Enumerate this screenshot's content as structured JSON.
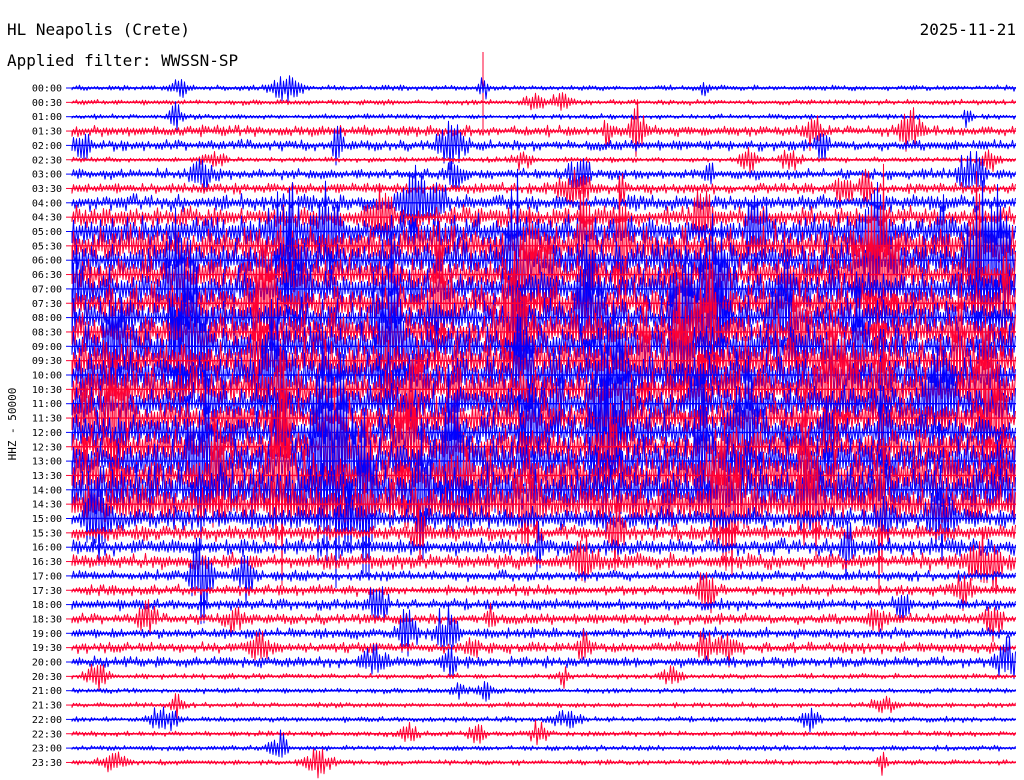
{
  "header": {
    "station": "HL Neapolis (Crete)",
    "date": "2025-11-21",
    "filter": "Applied filter: WWSSN-SP"
  },
  "colors": {
    "trace_a": "#0000ff",
    "trace_b": "#ff0033",
    "text": "#000000",
    "background": "#ffffff"
  },
  "chart_data": {
    "type": "line",
    "ylabel": "HHZ - 50000",
    "grid": false,
    "legend": "none",
    "rows": [
      {
        "label": "00:00",
        "amplitude": 1
      },
      {
        "label": "00:30",
        "amplitude": 1
      },
      {
        "label": "01:00",
        "amplitude": 1
      },
      {
        "label": "01:30",
        "amplitude": 2
      },
      {
        "label": "02:00",
        "amplitude": 2
      },
      {
        "label": "02:30",
        "amplitude": 1
      },
      {
        "label": "03:00",
        "amplitude": 2
      },
      {
        "label": "03:30",
        "amplitude": 2
      },
      {
        "label": "04:00",
        "amplitude": 3
      },
      {
        "label": "04:30",
        "amplitude": 4
      },
      {
        "label": "05:00",
        "amplitude": 6
      },
      {
        "label": "05:30",
        "amplitude": 7
      },
      {
        "label": "06:00",
        "amplitude": 7
      },
      {
        "label": "06:30",
        "amplitude": 7
      },
      {
        "label": "07:00",
        "amplitude": 7
      },
      {
        "label": "07:30",
        "amplitude": 7
      },
      {
        "label": "08:00",
        "amplitude": 7
      },
      {
        "label": "08:30",
        "amplitude": 7
      },
      {
        "label": "09:00",
        "amplitude": 8
      },
      {
        "label": "09:30",
        "amplitude": 8
      },
      {
        "label": "10:00",
        "amplitude": 8
      },
      {
        "label": "10:30",
        "amplitude": 8
      },
      {
        "label": "11:00",
        "amplitude": 7
      },
      {
        "label": "11:30",
        "amplitude": 7
      },
      {
        "label": "12:00",
        "amplitude": 7
      },
      {
        "label": "12:30",
        "amplitude": 7
      },
      {
        "label": "13:00",
        "amplitude": 8
      },
      {
        "label": "13:30",
        "amplitude": 9
      },
      {
        "label": "14:00",
        "amplitude": 9
      },
      {
        "label": "14:30",
        "amplitude": 8
      },
      {
        "label": "15:00",
        "amplitude": 4
      },
      {
        "label": "15:30",
        "amplitude": 3
      },
      {
        "label": "16:00",
        "amplitude": 3
      },
      {
        "label": "16:30",
        "amplitude": 3
      },
      {
        "label": "17:00",
        "amplitude": 2
      },
      {
        "label": "17:30",
        "amplitude": 2
      },
      {
        "label": "18:00",
        "amplitude": 2
      },
      {
        "label": "18:30",
        "amplitude": 2
      },
      {
        "label": "19:00",
        "amplitude": 2
      },
      {
        "label": "19:30",
        "amplitude": 2
      },
      {
        "label": "20:00",
        "amplitude": 2
      },
      {
        "label": "20:30",
        "amplitude": 1
      },
      {
        "label": "21:00",
        "amplitude": 1
      },
      {
        "label": "21:30",
        "amplitude": 1
      },
      {
        "label": "22:00",
        "amplitude": 1
      },
      {
        "label": "22:30",
        "amplitude": 1
      },
      {
        "label": "23:00",
        "amplitude": 1
      },
      {
        "label": "23:30",
        "amplitude": 1
      }
    ]
  }
}
